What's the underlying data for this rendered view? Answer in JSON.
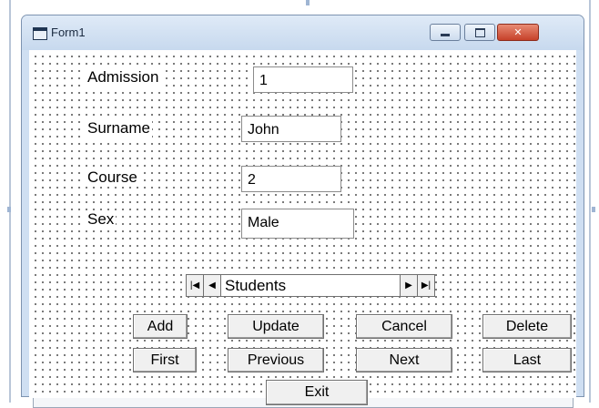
{
  "window": {
    "title": "Form1"
  },
  "labels": {
    "admission": "Admission",
    "surname": "Surname",
    "course": "Course",
    "sex": "Sex"
  },
  "fields": {
    "admission": "1",
    "surname": "John",
    "course": "2",
    "sex": "Male"
  },
  "data_control": {
    "caption": "Students",
    "first_icon": "move-first-icon",
    "prev_icon": "move-previous-icon",
    "next_icon": "move-next-icon",
    "last_icon": "move-last-icon"
  },
  "buttons": {
    "add": "Add",
    "update": "Update",
    "cancel": "Cancel",
    "delete": "Delete",
    "first": "First",
    "previous": "Previous",
    "next": "Next",
    "last": "Last",
    "exit": "Exit"
  },
  "icons": {
    "app": "form-icon",
    "minimize": "minimize-icon",
    "maximize": "maximize-icon",
    "close": "close-icon"
  }
}
